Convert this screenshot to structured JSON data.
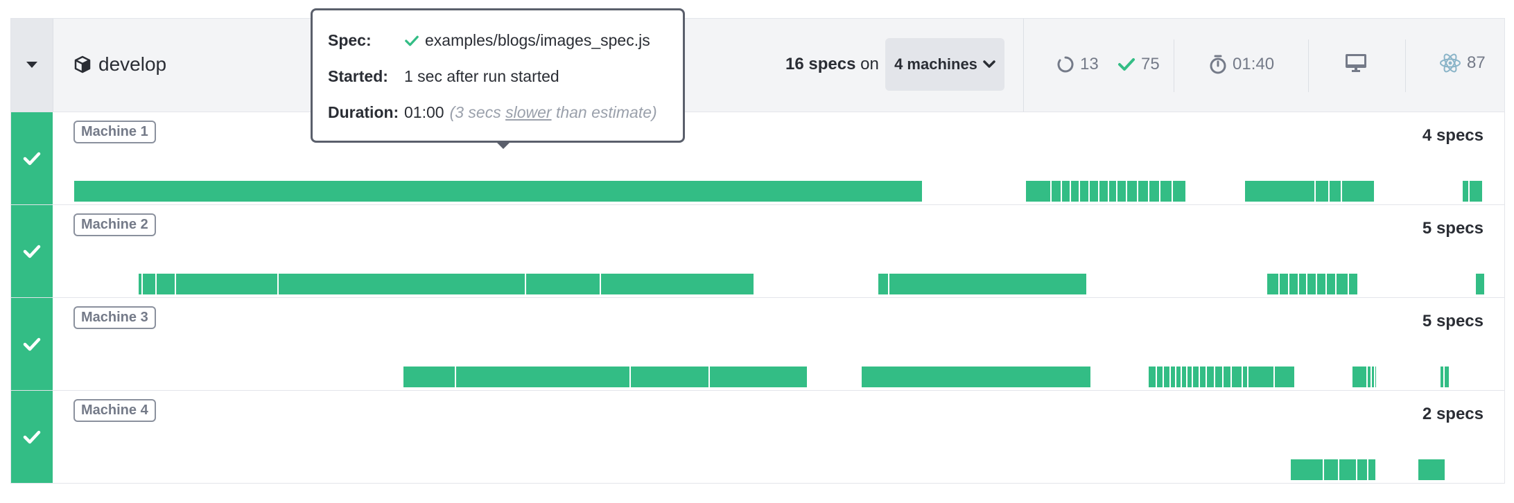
{
  "header": {
    "branch": "develop",
    "specs_count": "16 specs",
    "specs_on": "on",
    "machines_label": "4 machines",
    "pending_count": "13",
    "passed_count": "75",
    "duration": "01:40",
    "electron_count": "87"
  },
  "tooltip": {
    "spec_key": "Spec:",
    "spec_value": "examples/blogs/images_spec.js",
    "started_key": "Started:",
    "started_value": "1 sec after run started",
    "duration_key": "Duration:",
    "duration_value": "01:00",
    "duration_note_pre": "(3 secs ",
    "duration_note_word": "slower",
    "duration_note_post": " than estimate)"
  },
  "machines": [
    {
      "label": "Machine 1",
      "specs": "4 specs"
    },
    {
      "label": "Machine 2",
      "specs": "5 specs"
    },
    {
      "label": "Machine 3",
      "specs": "5 specs"
    },
    {
      "label": "Machine 4",
      "specs": "2 specs"
    }
  ],
  "colors": {
    "pass": "#33bd85",
    "header_bg": "#f3f4f6",
    "text": "#2a2d34",
    "muted": "#747a88"
  }
}
